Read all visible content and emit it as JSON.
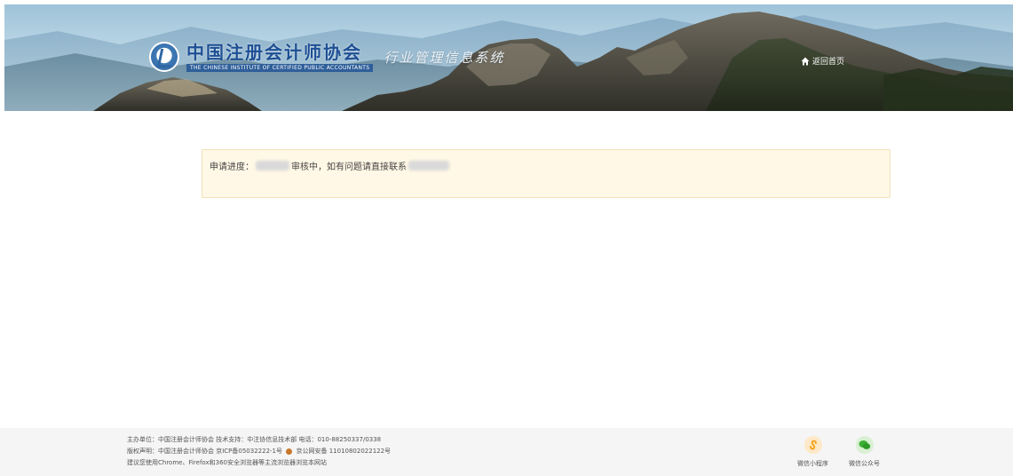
{
  "header": {
    "org_name_cn": "中国注册会计师协会",
    "org_name_en": "THE CHINESE INSTITUTE OF CERTIFIED PUBLIC ACCOUNTANTS",
    "system_name": "行业管理信息系统",
    "home_link": "返回首页",
    "home_icon": "home-icon"
  },
  "notice": {
    "prefix": "申请进度：",
    "status_text": "审核中，如有问题请直接联系"
  },
  "footer": {
    "line1": "主办单位：中国注册会计师协会 技术支持：中注协信息技术部 电话：010-88250337/0338",
    "line2_a": "版权声明：中国注册会计师协会 京ICP备05032222-1号",
    "line2_b": "京公网安备 11010802022122号",
    "line3": "建议您使用Chrome、Firefox和360安全浏览器等主流浏览器浏览本网站",
    "mini_program_label": "微信小程序",
    "official_account_label": "微信公众号"
  },
  "colors": {
    "notice_bg": "#fff8e6",
    "mini_program": "#f5a623",
    "wechat": "#3cb034"
  }
}
